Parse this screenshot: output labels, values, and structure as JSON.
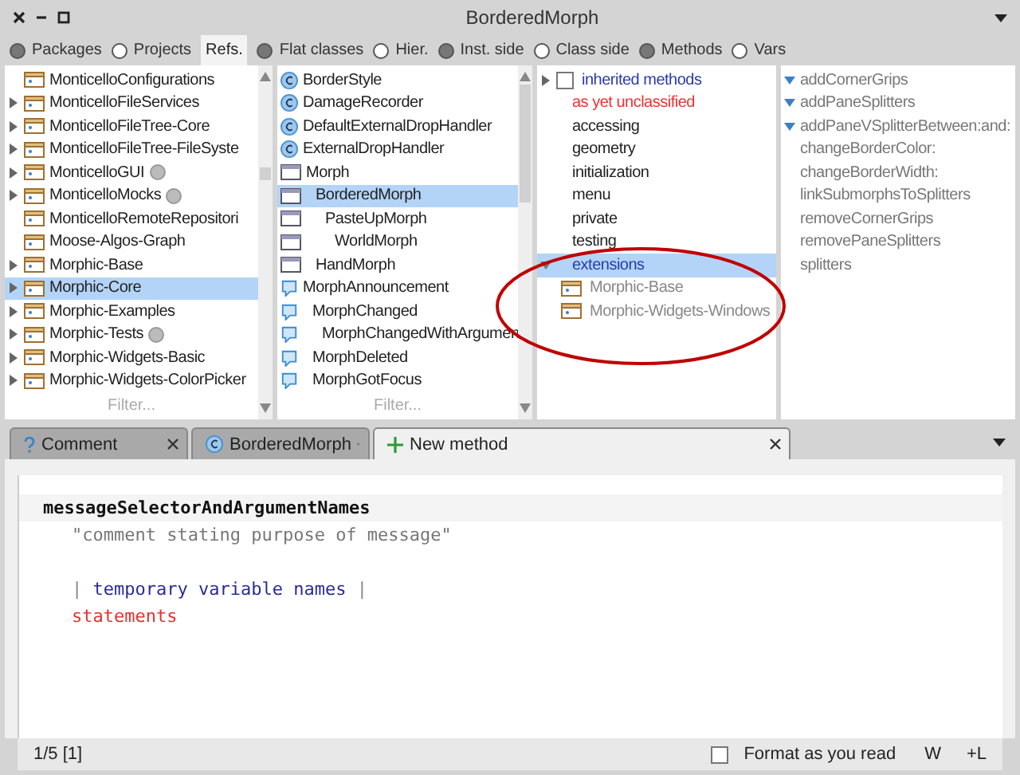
{
  "window": {
    "title": "BorderedMorph"
  },
  "options": [
    {
      "label": "Packages",
      "kind": "radio",
      "selected": true
    },
    {
      "label": "Projects",
      "kind": "radio",
      "selected": false
    },
    {
      "label": "Refs.",
      "kind": "toggle",
      "selected": false
    },
    {
      "label": "Flat classes",
      "kind": "radio",
      "selected": true
    },
    {
      "label": "Hier.",
      "kind": "radio",
      "selected": false
    },
    {
      "label": "Inst. side",
      "kind": "radio",
      "selected": true
    },
    {
      "label": "Class side",
      "kind": "radio",
      "selected": false
    },
    {
      "label": "Methods",
      "kind": "radio",
      "selected": true
    },
    {
      "label": "Vars",
      "kind": "radio",
      "selected": false
    }
  ],
  "packages": {
    "filter_placeholder": "Filter...",
    "items": [
      {
        "name": "MonticelloConfigurations",
        "expandable": false,
        "badge": false,
        "selected": false
      },
      {
        "name": "MonticelloFileServices",
        "expandable": true,
        "badge": false,
        "selected": false
      },
      {
        "name": "MonticelloFileTree-Core",
        "expandable": true,
        "badge": false,
        "selected": false
      },
      {
        "name": "MonticelloFileTree-FileSyste",
        "expandable": true,
        "badge": false,
        "selected": false
      },
      {
        "name": "MonticelloGUI",
        "expandable": true,
        "badge": true,
        "selected": false
      },
      {
        "name": "MonticelloMocks",
        "expandable": true,
        "badge": true,
        "selected": false
      },
      {
        "name": "MonticelloRemoteRepositori",
        "expandable": false,
        "badge": false,
        "selected": false
      },
      {
        "name": "Moose-Algos-Graph",
        "expandable": false,
        "badge": false,
        "selected": false
      },
      {
        "name": "Morphic-Base",
        "expandable": true,
        "badge": false,
        "selected": false
      },
      {
        "name": "Morphic-Core",
        "expandable": true,
        "badge": false,
        "selected": true
      },
      {
        "name": "Morphic-Examples",
        "expandable": true,
        "badge": false,
        "selected": false
      },
      {
        "name": "Morphic-Tests",
        "expandable": true,
        "badge": true,
        "selected": false
      },
      {
        "name": "Morphic-Widgets-Basic",
        "expandable": true,
        "badge": false,
        "selected": false
      },
      {
        "name": "Morphic-Widgets-ColorPicker",
        "expandable": true,
        "badge": false,
        "selected": false
      }
    ]
  },
  "classes": {
    "filter_placeholder": "Filter...",
    "items": [
      {
        "name": "BorderStyle",
        "kind": "class",
        "selected": false
      },
      {
        "name": "DamageRecorder",
        "kind": "class",
        "selected": false
      },
      {
        "name": "DefaultExternalDropHandler",
        "kind": "class",
        "selected": false
      },
      {
        "name": "ExternalDropHandler",
        "kind": "class",
        "selected": false
      },
      {
        "name": "Morph",
        "kind": "morph",
        "selected": false,
        "children": [
          {
            "name": "BorderedMorph",
            "kind": "morph",
            "selected": true,
            "children": [
              {
                "name": "PasteUpMorph",
                "kind": "morph",
                "selected": false,
                "children": [
                  {
                    "name": "WorldMorph",
                    "kind": "morph",
                    "selected": false
                  }
                ]
              }
            ]
          },
          {
            "name": "HandMorph",
            "kind": "morph",
            "selected": false
          }
        ]
      },
      {
        "name": "MorphAnnouncement",
        "kind": "announcement",
        "selected": false,
        "children": [
          {
            "name": "MorphChanged",
            "kind": "announcement",
            "selected": false,
            "children": [
              {
                "name": "MorphChangedWithArgumen",
                "kind": "announcement",
                "selected": false
              }
            ]
          },
          {
            "name": "MorphDeleted",
            "kind": "announcement",
            "selected": false
          },
          {
            "name": "MorphGotFocus",
            "kind": "announcement",
            "selected": false
          }
        ]
      }
    ]
  },
  "protocols": [
    {
      "name": "inherited methods",
      "kind": "inherited",
      "checked": false,
      "selected": false
    },
    {
      "name": "as yet unclassified",
      "kind": "unclassified",
      "selected": false
    },
    {
      "name": "accessing",
      "kind": "plain",
      "selected": false
    },
    {
      "name": "geometry",
      "kind": "plain",
      "selected": false
    },
    {
      "name": "initialization",
      "kind": "plain",
      "selected": false
    },
    {
      "name": "menu",
      "kind": "plain",
      "selected": false
    },
    {
      "name": "private",
      "kind": "plain",
      "selected": false
    },
    {
      "name": "testing",
      "kind": "plain",
      "selected": false
    },
    {
      "name": "extensions",
      "kind": "group",
      "expanded": true,
      "selected": true,
      "children": [
        {
          "name": "Morphic-Base",
          "kind": "package",
          "selected": false
        },
        {
          "name": "Morphic-Widgets-Windows",
          "kind": "package",
          "selected": false
        }
      ]
    }
  ],
  "callout": {
    "kind": "ellipse",
    "color": "#c00000"
  },
  "methods": [
    {
      "name": "addCornerGrips",
      "overridden": true
    },
    {
      "name": "addPaneSplitters",
      "overridden": true
    },
    {
      "name": "addPaneVSplitterBetween:and:",
      "overridden": true
    },
    {
      "name": "changeBorderColor:",
      "overridden": false
    },
    {
      "name": "changeBorderWidth:",
      "overridden": false
    },
    {
      "name": "linkSubmorphsToSplitters",
      "overridden": false
    },
    {
      "name": "removeCornerGrips",
      "overridden": false
    },
    {
      "name": "removePaneSplitters",
      "overridden": false
    },
    {
      "name": "splitters",
      "overridden": false
    }
  ],
  "tabs": [
    {
      "label": "Comment",
      "kind": "comment",
      "selected": false
    },
    {
      "label": "BorderedMorph",
      "kind": "class",
      "selected": false
    },
    {
      "label": "New method",
      "kind": "new",
      "selected": true
    }
  ],
  "editor": {
    "lines": [
      {
        "kind": "selector",
        "text": "messageSelectorAndArgumentNames"
      },
      {
        "kind": "comment",
        "text": "\"comment stating purpose of message\""
      },
      {
        "kind": "blank"
      },
      {
        "kind": "temps",
        "bar_open": "|",
        "text": "temporary variable names",
        "bar_close": "|"
      },
      {
        "kind": "statements",
        "text": "statements"
      }
    ]
  },
  "status_bar": {
    "position": "1/5 [1]",
    "format_label": "Format as you read",
    "format_checked": false,
    "mode": "W",
    "line_end": "+L"
  }
}
